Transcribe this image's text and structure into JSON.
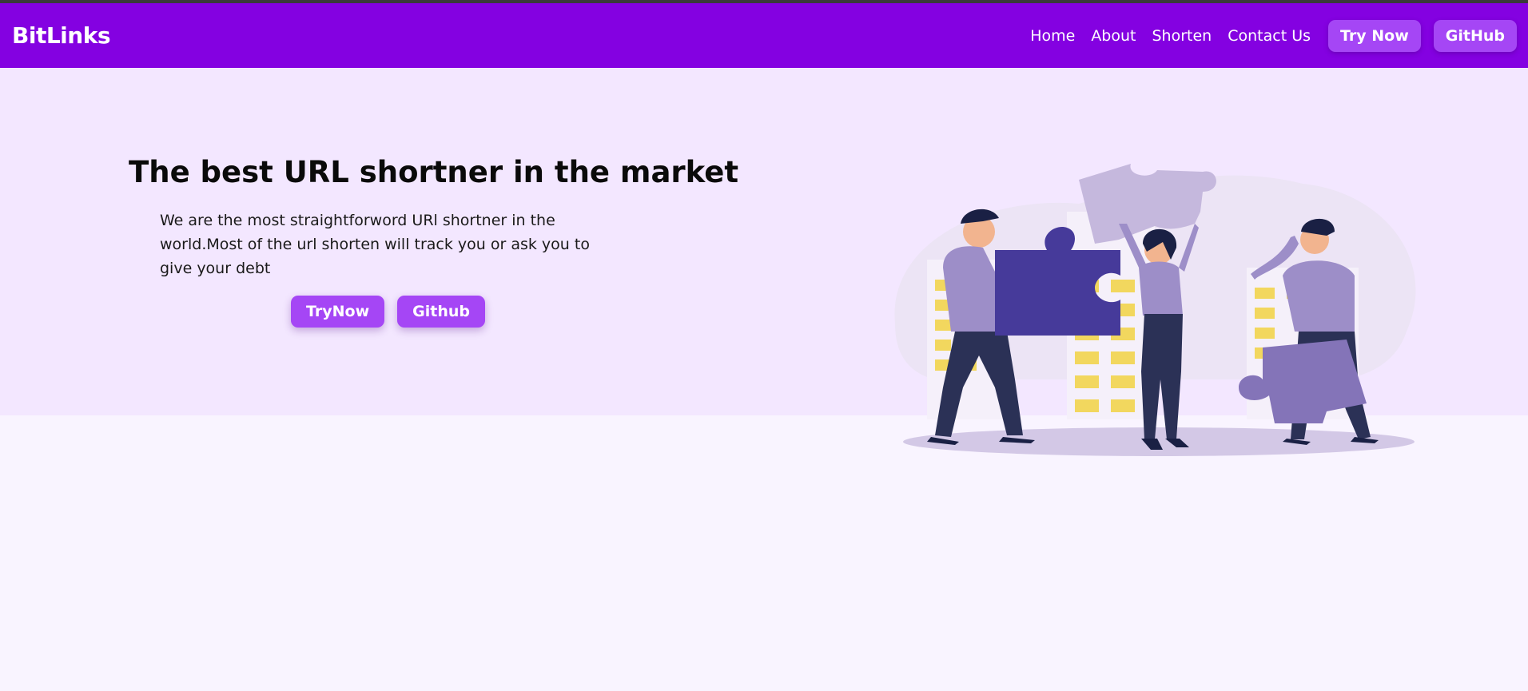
{
  "navbar": {
    "brand": "BitLinks",
    "links": [
      "Home",
      "About",
      "Shorten",
      "Contact Us"
    ],
    "try_now_label": "Try Now",
    "github_label": "GitHub",
    "background_color": "#8401e1",
    "button_color": "#a546f5"
  },
  "hero": {
    "title": "The best URL shortner in the market",
    "description": "We are the most straightforword URl shortner in the world.Most of the url shorten will track you or ask you to give your debt",
    "try_now_label": "TryNow",
    "github_label": "Github",
    "illustration_icon": "team-puzzle-illustration",
    "background_color": "#f3e7ff"
  },
  "page": {
    "background_color": "#f9f4ff"
  }
}
